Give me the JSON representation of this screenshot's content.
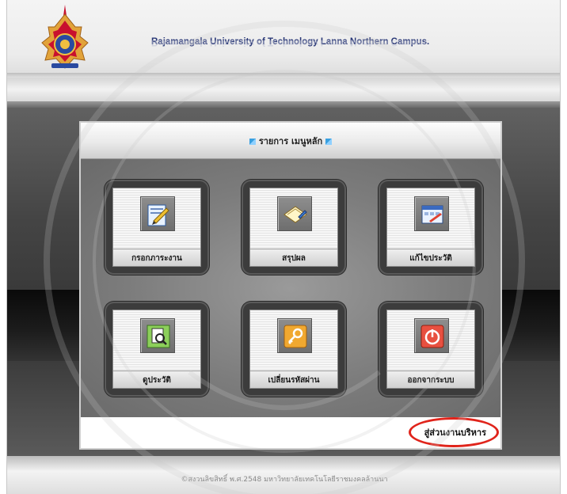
{
  "header": {
    "university_title": "Rajamangala University of Technology Lanna Northern Campus."
  },
  "panel": {
    "title": "รายการ เมนูหลัก"
  },
  "tiles": [
    {
      "label": "กรอกภาระงาน",
      "icon": "document-edit-icon"
    },
    {
      "label": "สรุปผล",
      "icon": "notebook-icon"
    },
    {
      "label": "แก้ไขประวัติ",
      "icon": "calendar-icon"
    },
    {
      "label": "ดูประวัติ",
      "icon": "view-document-icon"
    },
    {
      "label": "เปลี่ยนรหัสผ่าน",
      "icon": "key-icon"
    },
    {
      "label": "ออกจากระบบ",
      "icon": "power-icon"
    }
  ],
  "admin_link": "สู่ส่วนงานบริหาร",
  "footer": {
    "copyright": "©สงวนลิขสิทธิ์ พ.ศ.2548 มหาวิทยาลัยเทคโนโลยีราชมงคลล้านนา"
  },
  "colors": {
    "highlight_ring": "#e0241b",
    "title_blue": "#2c3a78"
  }
}
